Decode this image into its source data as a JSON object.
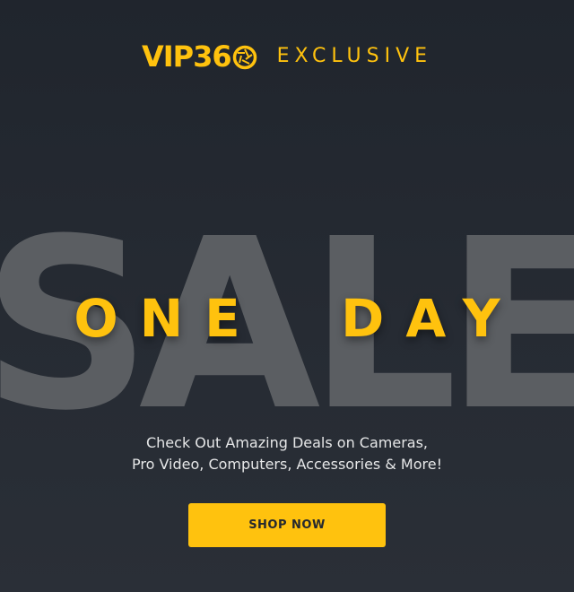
{
  "brand": {
    "logo_text": "VIP36",
    "logo_icon": "aperture-zero-icon",
    "tag": "EXCLUSIVE"
  },
  "hero": {
    "background_word": "SALE",
    "headline": "ONE  DAY"
  },
  "description": {
    "line1": "Check Out Amazing Deals on Cameras,",
    "line2": "Pro Video, Computers, Accessories & More!"
  },
  "cta": {
    "label": "SHOP NOW"
  },
  "colors": {
    "accent": "#ffc20e",
    "background": "#23282f",
    "sale_text": "#5b5e62",
    "body_text": "#e6e7e8"
  }
}
